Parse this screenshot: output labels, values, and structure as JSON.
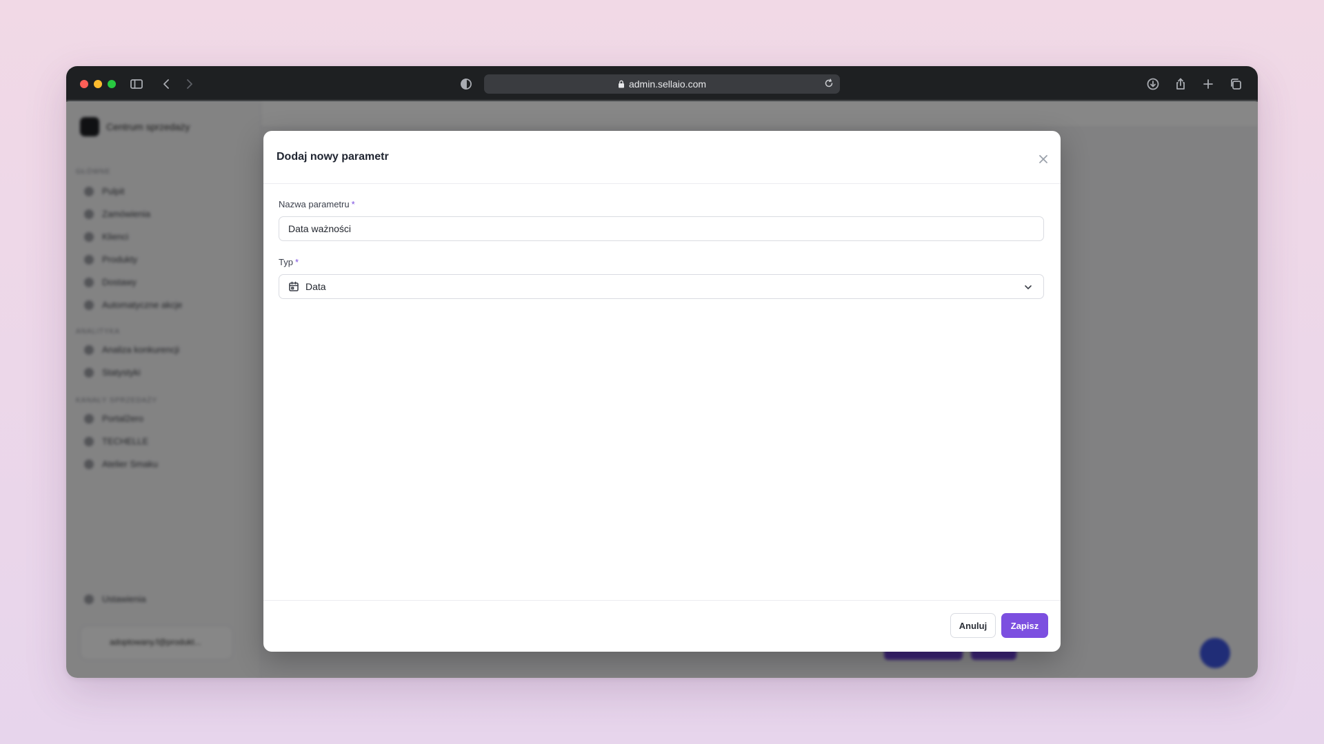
{
  "browser": {
    "url": "admin.sellaio.com"
  },
  "background_app": {
    "brand": "Centrum sprzedaży",
    "sections": [
      {
        "title": "Główne",
        "items": [
          "Pulpit",
          "Zamówienia",
          "Klienci",
          "Produkty",
          "Dostawy",
          "Automatyczne akcje"
        ]
      },
      {
        "title": "Analityka",
        "items": [
          "Analiza konkurencji",
          "Statystyki"
        ]
      },
      {
        "title": "Kanały sprzedaży",
        "items": [
          "Portal2ero",
          "TECHELLE",
          "Atelier Smaku"
        ]
      }
    ],
    "settings_label": "Ustawienia",
    "user_email": "adoptowany.f@produkt..."
  },
  "modal": {
    "title": "Dodaj nowy parametr",
    "name_label": "Nazwa parametru",
    "required_mark": "*",
    "name_value": "Data ważności",
    "type_label": "Typ",
    "type_value": "Data",
    "type_icon": "calendar-icon",
    "cancel_label": "Anuluj",
    "save_label": "Zapisz"
  },
  "colors": {
    "accent": "#7c4fe0",
    "chrome": "#1e2022",
    "backdrop": "#f1d9e6"
  }
}
